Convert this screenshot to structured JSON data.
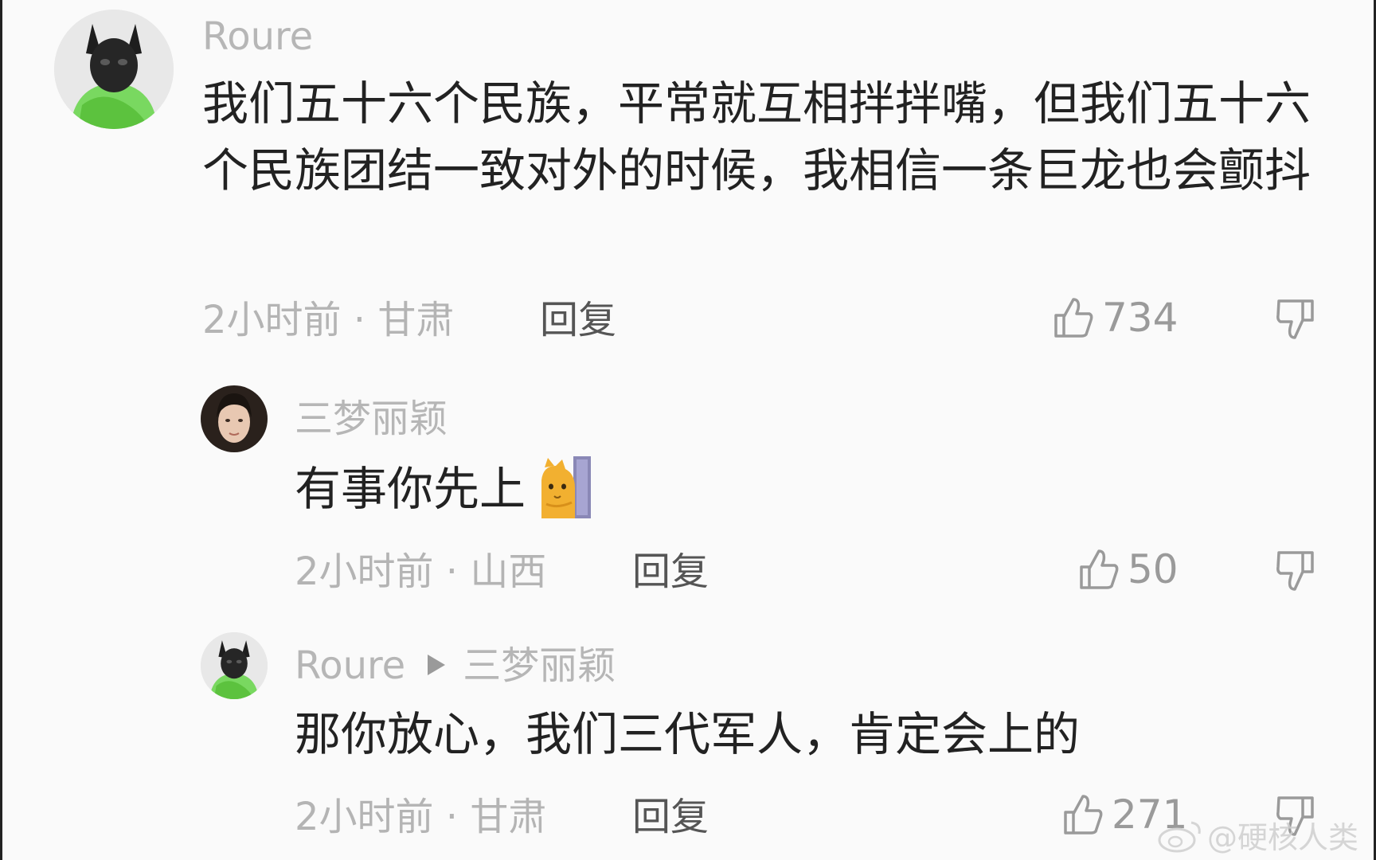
{
  "comments": [
    {
      "username": "Roure",
      "text": "我们五十六个民族，平常就互相拌拌嘴，但我们五十六个民族团结一致对外的时候，我相信一条巨龙也会颤抖",
      "meta": "2小时前 · 甘肃",
      "reply_label": "回复",
      "likes": "734",
      "avatar_icon": "black-cat-green-hoodie"
    },
    {
      "username": "三梦丽颖",
      "text": "有事你先上",
      "sticker_icon": "peeking-cat-sticker",
      "meta": "2小时前 · 山西",
      "reply_label": "回复",
      "likes": "50",
      "avatar_icon": "woman-portrait"
    },
    {
      "username": "Roure",
      "reply_to": "三梦丽颖",
      "text": "那你放心，我们三代军人，肯定会上的",
      "meta": "2小时前 · 甘肃",
      "reply_label": "回复",
      "likes": "271",
      "avatar_icon": "black-cat-green-hoodie"
    }
  ],
  "watermark": "@硬核人类",
  "colors": {
    "username": "#b6b6b6",
    "body_text": "#222222",
    "meta": "#b4b4b4",
    "reply": "#555555",
    "icon": "#9a9a9a"
  }
}
